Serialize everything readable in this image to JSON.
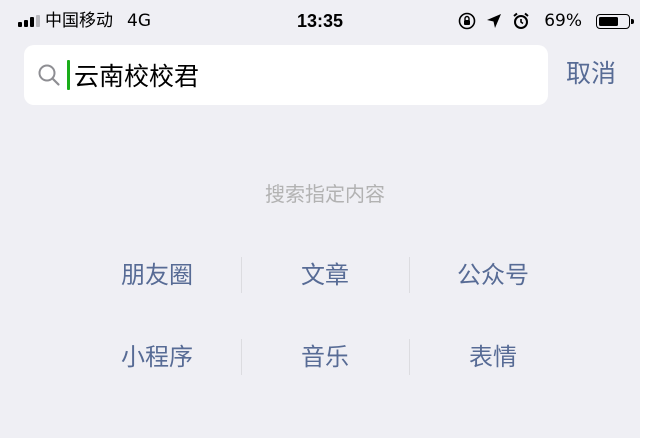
{
  "status_bar": {
    "carrier": "中国移动",
    "network": "4G",
    "time": "13:35",
    "battery_percent": "69%",
    "battery_level": 0.69,
    "icons": [
      "signal-icon",
      "orientation-lock-icon",
      "location-arrow-icon",
      "alarm-icon",
      "battery-icon"
    ]
  },
  "search": {
    "placeholder": "搜索",
    "value": "云南校校君",
    "cancel_label": "取消"
  },
  "hint": {
    "text": "搜索指定内容"
  },
  "categories": {
    "row1": [
      "朋友圈",
      "文章",
      "公众号"
    ],
    "row2": [
      "小程序",
      "音乐",
      "表情"
    ]
  },
  "colors": {
    "background": "#efeff4",
    "link": "#576b95",
    "caret": "#1aad19",
    "hint": "#b2b2b2"
  }
}
